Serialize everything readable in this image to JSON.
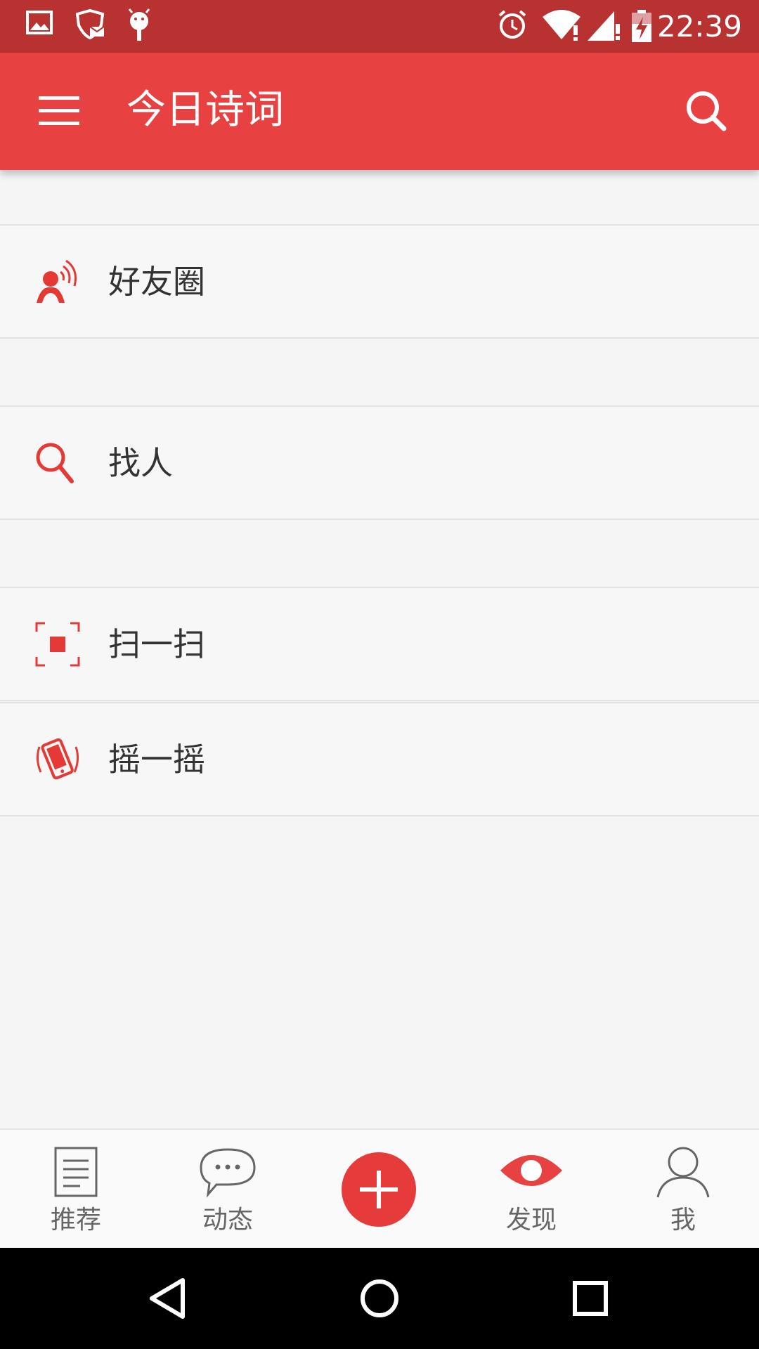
{
  "status_bar": {
    "time": "22:39",
    "left_icons": [
      "image-icon",
      "mail-shield-icon",
      "android-debug-icon"
    ],
    "right_icons": [
      "alarm-icon",
      "wifi-icon",
      "signal-icon",
      "battery-charging-icon"
    ]
  },
  "app_bar": {
    "title": "今日诗词",
    "menu_icon": "hamburger-menu-icon",
    "search_icon": "search-icon",
    "color": "#e84141"
  },
  "list": {
    "items": [
      {
        "label": "好友圈",
        "icon": "friends-circle-icon"
      },
      {
        "label": "找人",
        "icon": "find-people-icon"
      },
      {
        "label": "扫一扫",
        "icon": "scan-icon"
      },
      {
        "label": "摇一摇",
        "icon": "shake-icon"
      }
    ]
  },
  "bottom_nav": {
    "tabs": [
      {
        "label": "推荐",
        "icon": "document-icon",
        "active": false
      },
      {
        "label": "动态",
        "icon": "chat-bubble-icon",
        "active": false
      },
      {
        "label": "",
        "icon": "add-icon",
        "active": false
      },
      {
        "label": "发现",
        "icon": "eye-icon",
        "active": true
      },
      {
        "label": "我",
        "icon": "person-icon",
        "active": false
      }
    ],
    "active_color": "#e84141",
    "inactive_color": "#666666"
  },
  "system_nav": {
    "buttons": [
      "back-icon",
      "home-icon",
      "recents-icon"
    ]
  }
}
